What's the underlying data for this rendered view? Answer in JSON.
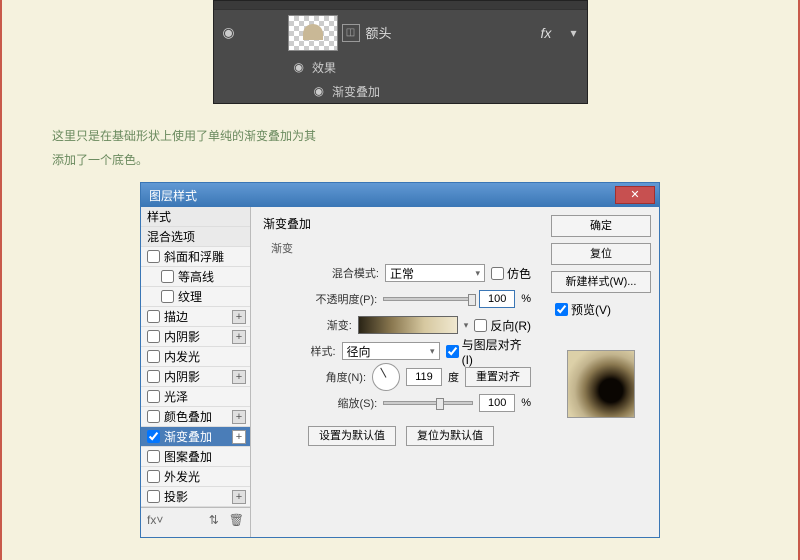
{
  "layers": {
    "layer_name": "额头",
    "fx": "fx",
    "effects_label": "效果",
    "effect_item": "渐变叠加"
  },
  "body_text": {
    "line1": "这里只是在基础形状上使用了单纯的渐变叠加为其",
    "line2": "添加了一个底色。"
  },
  "dialog": {
    "title": "图层样式",
    "left": {
      "header1": "样式",
      "header2": "混合选项",
      "items": [
        "斜面和浮雕",
        "等高线",
        "纹理",
        "描边",
        "内阴影",
        "内发光",
        "内阴影",
        "光泽",
        "颜色叠加",
        "渐变叠加",
        "图案叠加",
        "外发光",
        "投影"
      ]
    },
    "center": {
      "title": "渐变叠加",
      "group": "渐变",
      "blend_label": "混合模式:",
      "blend_value": "正常",
      "dither": "仿色",
      "opacity_label": "不透明度(P):",
      "opacity_value": "100",
      "pct": "%",
      "gradient_label": "渐变:",
      "reverse": "反向(R)",
      "style_label": "样式:",
      "style_value": "径向",
      "align": "与图层对齐(I)",
      "angle_label": "角度(N):",
      "angle_value": "119",
      "deg": "度",
      "reset_align": "重置对齐",
      "scale_label": "缩放(S):",
      "scale_value": "100",
      "make_default": "设置为默认值",
      "reset_default": "复位为默认值"
    },
    "right": {
      "ok": "确定",
      "cancel": "复位",
      "new_style": "新建样式(W)...",
      "preview": "预览(V)"
    }
  }
}
